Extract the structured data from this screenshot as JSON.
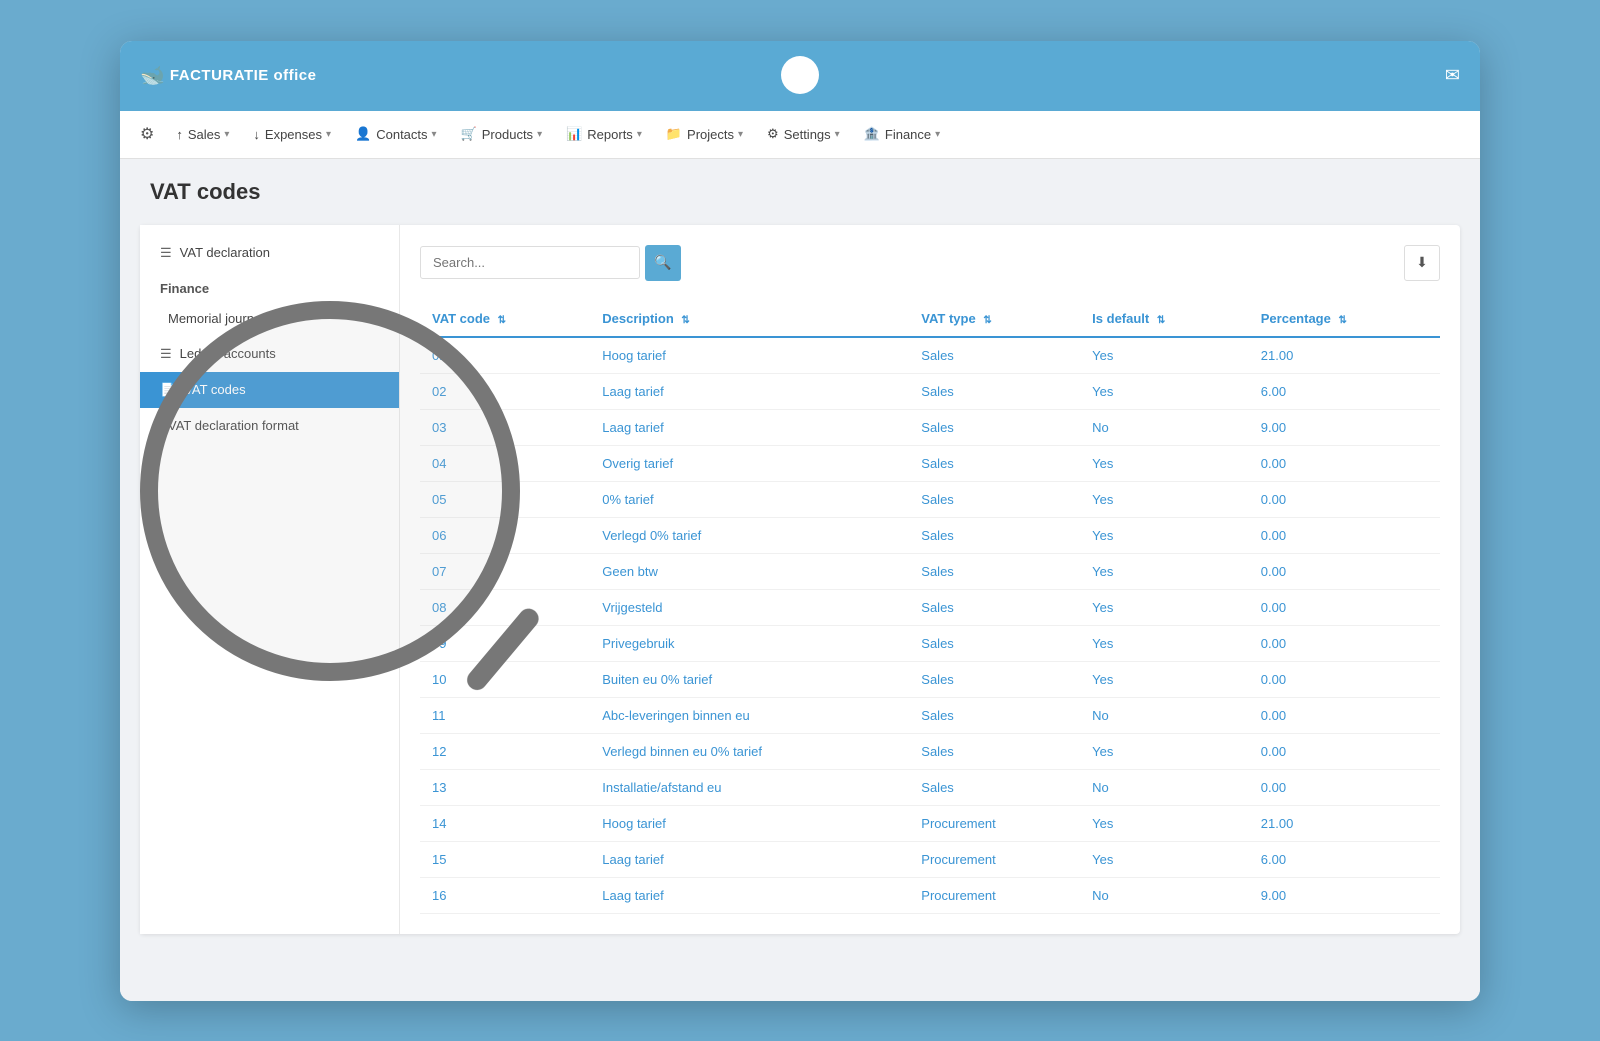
{
  "app": {
    "title": "FACTURATIE office",
    "page_title": "VAT codes"
  },
  "top_bar": {
    "email_icon": "✉"
  },
  "nav": {
    "home_icon": "⚙",
    "items": [
      {
        "id": "sales",
        "label": "Sales",
        "icon": "↑",
        "has_caret": true
      },
      {
        "id": "expenses",
        "label": "Expenses",
        "icon": "↓",
        "has_caret": true
      },
      {
        "id": "contacts",
        "label": "Contacts",
        "icon": "👤",
        "has_caret": true
      },
      {
        "id": "products",
        "label": "Products",
        "icon": "🛒",
        "has_caret": true
      },
      {
        "id": "reports",
        "label": "Reports",
        "icon": "📊",
        "has_caret": true
      },
      {
        "id": "projects",
        "label": "Projects",
        "icon": "📁",
        "has_caret": true
      },
      {
        "id": "settings",
        "label": "Settings",
        "icon": "⚙",
        "has_caret": true
      },
      {
        "id": "finance",
        "label": "Finance",
        "icon": "🏦",
        "has_caret": true
      }
    ]
  },
  "sidebar": {
    "vat_declaration": {
      "label": "VAT declaration",
      "icon": "☰"
    },
    "section_finance": "Finance",
    "items": [
      {
        "id": "memorial-journal",
        "label": "Memorial journal",
        "icon": ""
      },
      {
        "id": "ledger-accounts",
        "label": "Ledger accounts",
        "icon": "☰"
      },
      {
        "id": "vat-codes",
        "label": "VAT codes",
        "icon": "📄",
        "active": true
      },
      {
        "id": "vat-declaration-format",
        "label": "VAT declaration format",
        "icon": ""
      }
    ]
  },
  "search": {
    "placeholder": "Search...",
    "search_icon": "🔍",
    "download_icon": "⬇"
  },
  "table": {
    "columns": [
      {
        "id": "vat-code",
        "label": "VAT code"
      },
      {
        "id": "description",
        "label": "Description"
      },
      {
        "id": "vat-type",
        "label": "VAT type"
      },
      {
        "id": "is-default",
        "label": "Is default"
      },
      {
        "id": "percentage",
        "label": "Percentage"
      }
    ],
    "rows": [
      {
        "code": "01",
        "description": "Hoog tarief",
        "vat_type": "Sales",
        "is_default": "Yes",
        "percentage": "21.00"
      },
      {
        "code": "02",
        "description": "Laag tarief",
        "vat_type": "Sales",
        "is_default": "Yes",
        "percentage": "6.00"
      },
      {
        "code": "03",
        "description": "Laag tarief",
        "vat_type": "Sales",
        "is_default": "No",
        "percentage": "9.00"
      },
      {
        "code": "04",
        "description": "Overig tarief",
        "vat_type": "Sales",
        "is_default": "Yes",
        "percentage": "0.00"
      },
      {
        "code": "05",
        "description": "0% tarief",
        "vat_type": "Sales",
        "is_default": "Yes",
        "percentage": "0.00"
      },
      {
        "code": "06",
        "description": "Verlegd 0% tarief",
        "vat_type": "Sales",
        "is_default": "Yes",
        "percentage": "0.00"
      },
      {
        "code": "07",
        "description": "Geen btw",
        "vat_type": "Sales",
        "is_default": "Yes",
        "percentage": "0.00"
      },
      {
        "code": "08",
        "description": "Vrijgesteld",
        "vat_type": "Sales",
        "is_default": "Yes",
        "percentage": "0.00"
      },
      {
        "code": "09",
        "description": "Privegebruik",
        "vat_type": "Sales",
        "is_default": "Yes",
        "percentage": "0.00"
      },
      {
        "code": "10",
        "description": "Buiten eu 0% tarief",
        "vat_type": "Sales",
        "is_default": "Yes",
        "percentage": "0.00"
      },
      {
        "code": "11",
        "description": "Abc-leveringen binnen eu",
        "vat_type": "Sales",
        "is_default": "No",
        "percentage": "0.00"
      },
      {
        "code": "12",
        "description": "Verlegd binnen eu 0% tarief",
        "vat_type": "Sales",
        "is_default": "Yes",
        "percentage": "0.00"
      },
      {
        "code": "13",
        "description": "Installatie/afstand eu",
        "vat_type": "Sales",
        "is_default": "No",
        "percentage": "0.00"
      },
      {
        "code": "14",
        "description": "Hoog tarief",
        "vat_type": "Procurement",
        "is_default": "Yes",
        "percentage": "21.00"
      },
      {
        "code": "15",
        "description": "Laag tarief",
        "vat_type": "Procurement",
        "is_default": "Yes",
        "percentage": "6.00"
      },
      {
        "code": "16",
        "description": "Laag tarief",
        "vat_type": "Procurement",
        "is_default": "No",
        "percentage": "9.00"
      }
    ]
  },
  "colors": {
    "primary": "#3a94d4",
    "nav_bg": "#5aaad4",
    "active_sidebar": "#3a94d4"
  }
}
